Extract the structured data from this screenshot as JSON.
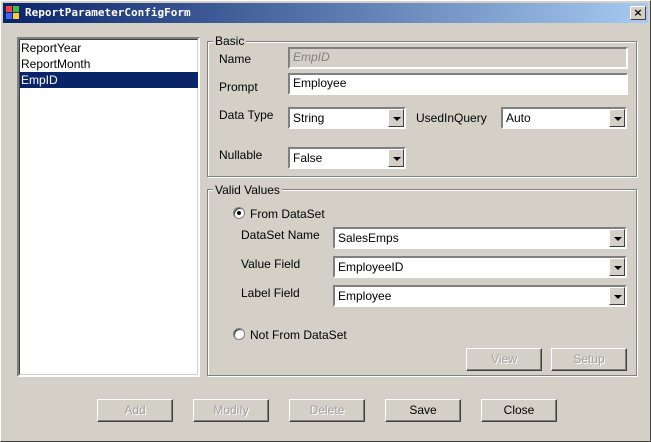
{
  "window": {
    "title": "ReportParameterConfigForm",
    "close_glyph": "×"
  },
  "parameters": [
    "ReportYear",
    "ReportMonth",
    "EmpID"
  ],
  "basic": {
    "label": "Basic",
    "name_label": "Name",
    "name_value": "EmpID",
    "prompt_label": "Prompt",
    "prompt_value": "Employee",
    "datatype_label": "Data Type",
    "datatype_value": "String",
    "usedinquery_label": "UsedInQuery",
    "usedinquery_value": "Auto",
    "nullable_label": "Nullable",
    "nullable_value": "False"
  },
  "valid_values": {
    "label": "Valid Values",
    "from_dataset_label": "From DataSet",
    "dataset_name_label": "DataSet Name",
    "dataset_name_value": "SalesEmps",
    "value_field_label": "Value Field",
    "value_field_value": "EmployeeID",
    "label_field_label": "Label Field",
    "label_field_value": "Employee",
    "not_from_dataset_label": "Not From DataSet",
    "view_label": "View",
    "setup_label": "Setup"
  },
  "buttons": {
    "add": "Add",
    "modify": "Modify",
    "delete": "Delete",
    "save": "Save",
    "close": "Close"
  },
  "colors": {
    "title_start": "#0a246a",
    "title_end": "#a6caf0",
    "selection": "#0a246a",
    "face": "#d4d0c8"
  }
}
